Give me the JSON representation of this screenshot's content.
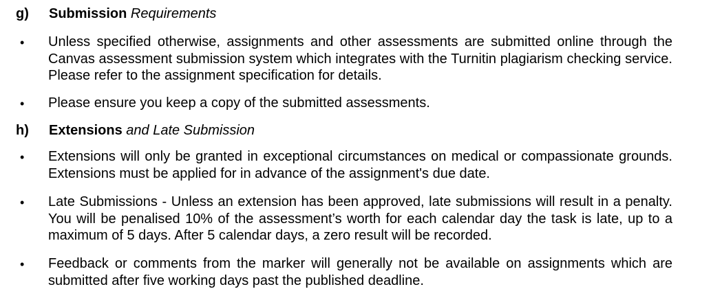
{
  "sections": [
    {
      "letter": "g)",
      "title_bold": "Submission",
      "title_italic": "Requirements",
      "bullets": [
        "Unless specified otherwise, assignments and other assessments are submitted online through the Canvas assessment submission system which integrates with the Turnitin plagiarism checking service. Please refer to the assignment specification for details.",
        "Please ensure you keep a copy of the submitted assessments."
      ]
    },
    {
      "letter": "h)",
      "title_bold": "Extensions",
      "title_italic": "and Late Submission",
      "bullets": [
        "Extensions will only be granted in exceptional circumstances on medical or compassionate grounds. Extensions must be applied for in advance of the assignment's due date.",
        "Late Submissions - Unless an extension has been approved, late submissions will result in a penalty. You will be penalised 10% of the assessment’s worth for each calendar day the task is late, up to a maximum of 5 days. After 5 calendar days, a zero result will be recorded.",
        "Feedback or comments from the marker will generally not be available on assignments which are submitted after five working days past the published deadline."
      ]
    }
  ],
  "bullet_glyph": "•"
}
